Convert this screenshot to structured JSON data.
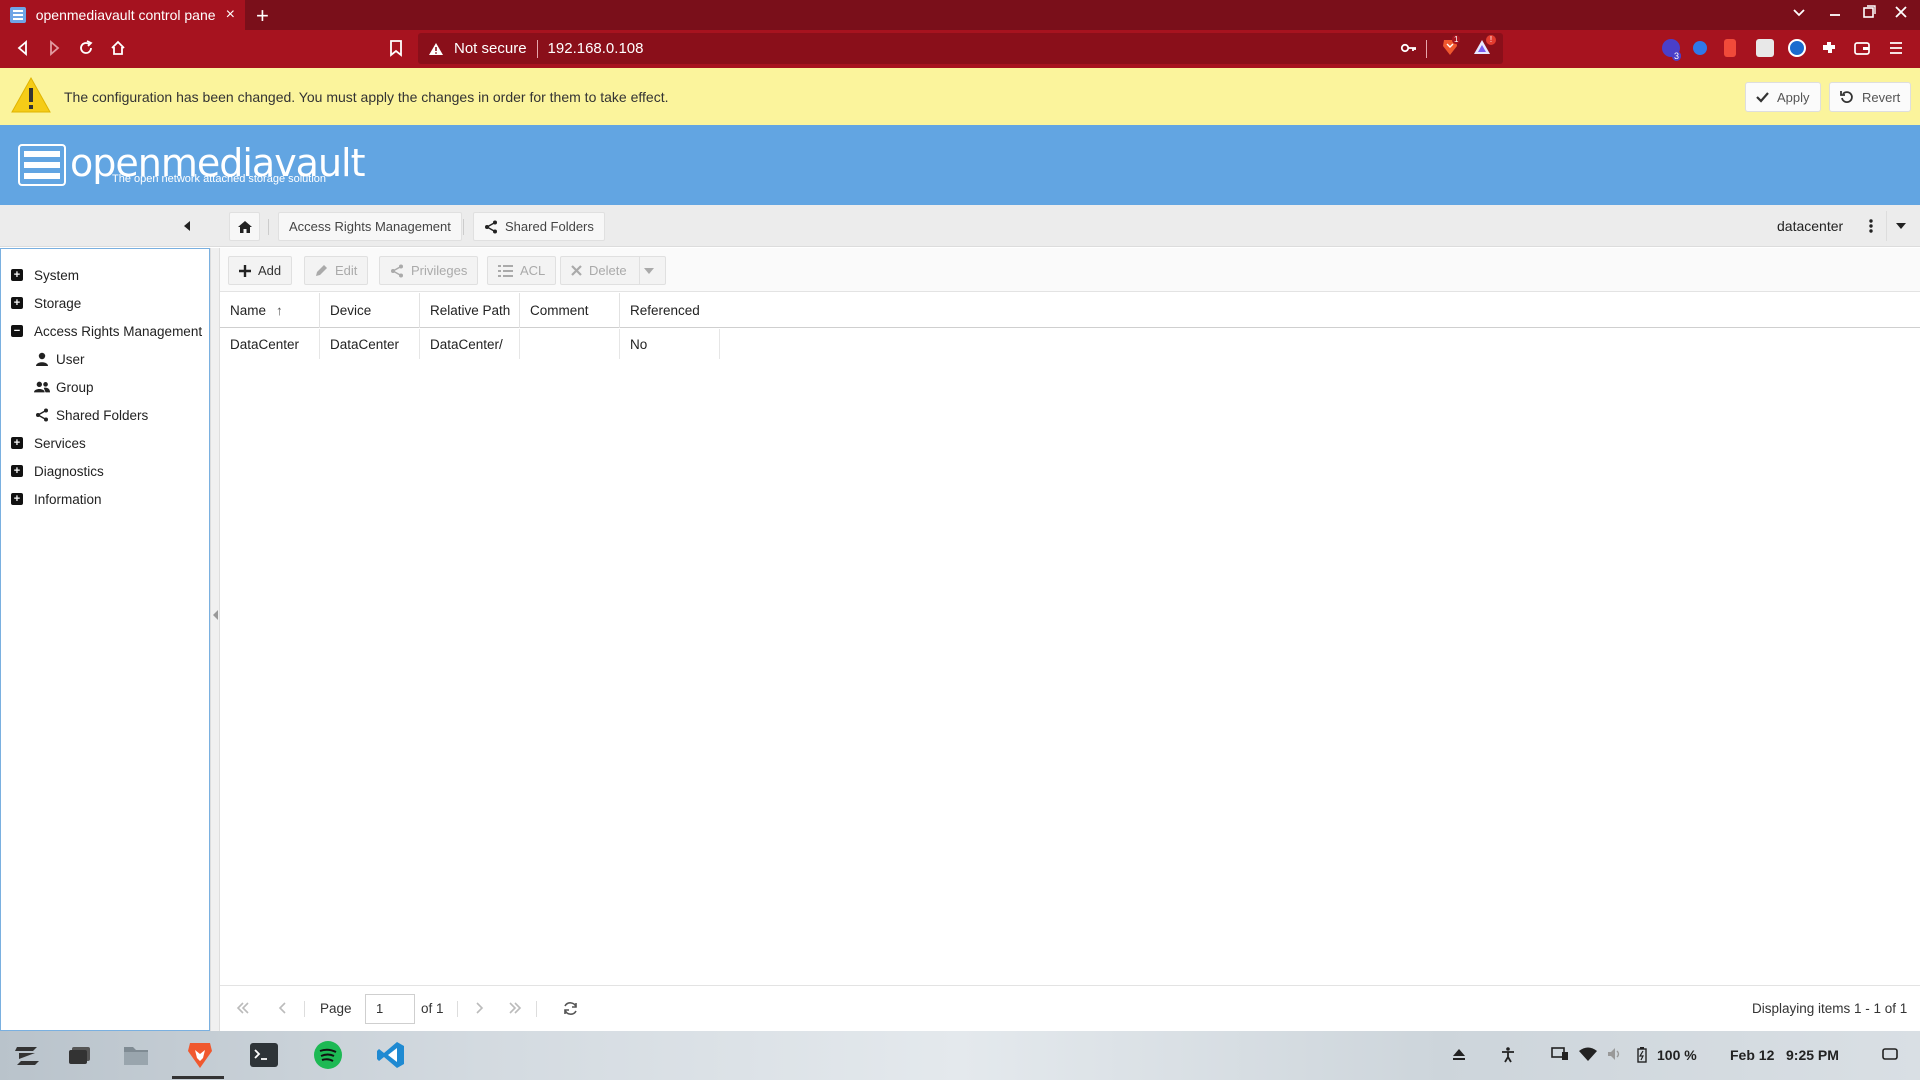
{
  "browser": {
    "tab_title": "openmediavault control pane",
    "tab_close": "×",
    "new_tab": "+",
    "url_warning": "Not secure",
    "url": "192.168.0.108",
    "ext_badge_shield": "1",
    "ext_badge_alert": "!",
    "ext_badge_count": "3"
  },
  "notice": {
    "message": "The configuration has been changed. You must apply the changes in order for them to take effect.",
    "apply_label": "Apply",
    "revert_label": "Revert"
  },
  "header": {
    "logo": "openmediavault",
    "tagline": "The open network attached storage solution"
  },
  "breadcrumb": {
    "items": [
      "Access Rights Management",
      "Shared Folders"
    ],
    "user": "datacenter"
  },
  "sidebar": {
    "items": [
      {
        "label": "System",
        "state": "+"
      },
      {
        "label": "Storage",
        "state": "+"
      },
      {
        "label": "Access Rights Management",
        "state": "−"
      },
      {
        "label": "User"
      },
      {
        "label": "Group"
      },
      {
        "label": "Shared Folders"
      },
      {
        "label": "Services",
        "state": "+"
      },
      {
        "label": "Diagnostics",
        "state": "+"
      },
      {
        "label": "Information",
        "state": "+"
      }
    ]
  },
  "toolbar": {
    "add": "Add",
    "edit": "Edit",
    "privileges": "Privileges",
    "acl": "ACL",
    "delete": "Delete"
  },
  "grid": {
    "columns": [
      "Name",
      "Device",
      "Relative Path",
      "Comment",
      "Referenced"
    ],
    "sort_indicator": "↑",
    "rows": [
      [
        "DataCenter",
        "DataCenter",
        "DataCenter/",
        "",
        "No"
      ]
    ]
  },
  "pager": {
    "page_label": "Page",
    "page_value": "1",
    "of_label": "of 1",
    "status": "Displaying items 1 - 1 of 1"
  },
  "taskbar": {
    "battery": "100 %",
    "date": "Feb 12",
    "time": "9:25 PM"
  },
  "colors": {
    "tab_bar": "#7a0f1a",
    "address_bar": "#a7131f",
    "notice": "#fbf49c",
    "header": "#62a5e2"
  }
}
